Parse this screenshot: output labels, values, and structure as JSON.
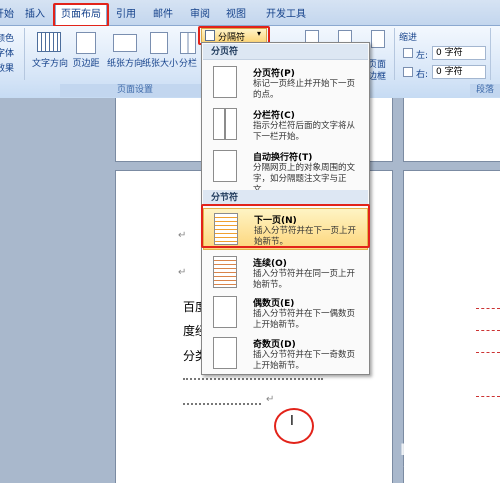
{
  "tabs": [
    "开始",
    "插入",
    "页面布局",
    "引用",
    "邮件",
    "审阅",
    "视图",
    "开发工具"
  ],
  "ribbon": {
    "left_labels": [
      "颜色",
      "字体",
      "效果"
    ],
    "buttons": [
      "文字方向",
      "页边距",
      "纸张方向",
      "纸张大小",
      "分栏"
    ],
    "breaks_button": "分隔符",
    "page_border": "页面",
    "page_border2": "边框",
    "indent_title": "缩进",
    "indent_left_label": "左:",
    "indent_right_label": "右:",
    "indent_left_value": "0 字符",
    "indent_right_value": "0 字符",
    "group_page_setup": "页面设置",
    "group_paragraph": "段落"
  },
  "menu": {
    "section1": "分页符",
    "section2": "分节符",
    "items": [
      {
        "title": "分页符(P)",
        "desc": "标记一页终止并开始下一页的点。"
      },
      {
        "title": "分栏符(C)",
        "desc": "指示分栏符后面的文字将从下一栏开始。"
      },
      {
        "title": "自动换行符(T)",
        "desc": "分隔网页上的对象周围的文字，如分隔题注文字与正文。"
      },
      {
        "title": "下一页(N)",
        "desc": "插入分节符并在下一页上开始新节。"
      },
      {
        "title": "连续(O)",
        "desc": "插入分节符并在同一页上开始新节。"
      },
      {
        "title": "偶数页(E)",
        "desc": "插入分节符并在下一偶数页上开始新节。"
      },
      {
        "title": "奇数页(D)",
        "desc": "插入分节符并在下一奇数页上开始新节。"
      }
    ]
  },
  "doc": {
    "line1": "百度",
    "line2": "度经",
    "line3": "分类",
    "return_mark": "↵",
    "cursor": "I"
  },
  "watermark": "Baidu 经验",
  "watermark_url": "jingyan.baidu.com"
}
